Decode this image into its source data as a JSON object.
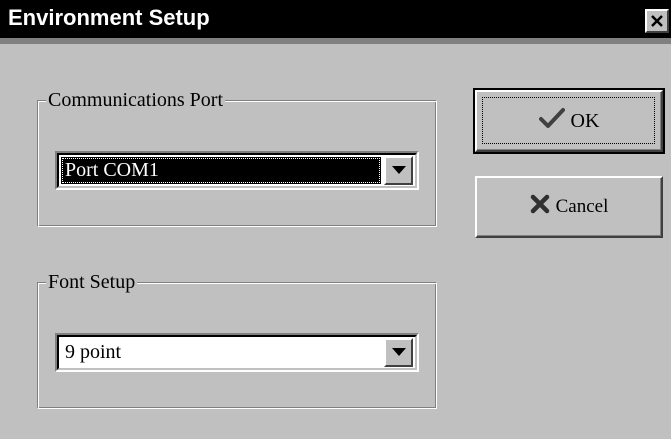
{
  "window": {
    "title": "Environment Setup"
  },
  "title_bar": {
    "close_icon": "close-icon"
  },
  "comm_port": {
    "label": "Communications Port",
    "value": "Port COM1",
    "dropdown_icon": "chevron-down-icon"
  },
  "font_setup": {
    "label": "Font Setup",
    "value": "9 point",
    "dropdown_icon": "chevron-down-icon"
  },
  "buttons": {
    "ok_label": "OK",
    "ok_icon": "checkmark-icon",
    "cancel_label": "Cancel",
    "cancel_icon": "x-mark-icon"
  },
  "colors": {
    "face": "#c0c0c0",
    "titlebar": "#000000",
    "selection": "#000000",
    "text": "#000000",
    "highlight": "#ffffff",
    "shadow": "#808080"
  }
}
